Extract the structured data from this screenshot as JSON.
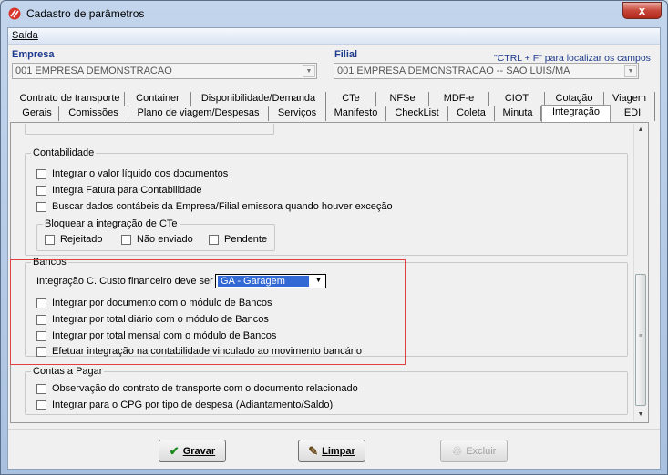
{
  "window": {
    "title": "Cadastro de parâmetros",
    "close_glyph": "x"
  },
  "menu": {
    "saida": "Saída"
  },
  "empresa": {
    "label": "Empresa",
    "value": "001 EMPRESA DEMONSTRACAO"
  },
  "filial": {
    "label": "Filial",
    "value": "001 EMPRESA DEMONSTRACAO -- SAO LUIS/MA",
    "hint": "\"CTRL + F\" para localizar os campos"
  },
  "tabs_row1": [
    "Contrato de transporte",
    "Container",
    "Disponibilidade/Demanda",
    "CTe",
    "NFSe",
    "MDF-e",
    "CIOT",
    "Cotação",
    "Viagem"
  ],
  "tabs_row2": [
    "Gerais",
    "Comissões",
    "Plano de viagem/Despesas",
    "Serviços",
    "Manifesto",
    "CheckList",
    "Coleta",
    "Minuta",
    "Integração",
    "EDI"
  ],
  "active_tab": "Integração",
  "contabilidade": {
    "title": "Contabilidade",
    "items": [
      "Integrar o valor líquido dos documentos",
      "Integra Fatura para Contabilidade",
      "Buscar dados contábeis da Empresa/Filial emissora quando houver exceção"
    ],
    "bloquear": {
      "title": "Bloquear a integração de CTe",
      "items": [
        "Rejeitado",
        "Não enviado",
        "Pendente"
      ]
    }
  },
  "bancos": {
    "title": "Bancos",
    "custo_label": "Integração C. Custo financeiro deve ser por",
    "custo_value": "GA - Garagem",
    "items": [
      "Integrar por documento com o módulo de Bancos",
      "Integrar por total diário com o módulo de Bancos",
      "Integrar por total mensal com o módulo de Bancos",
      "Efetuar integração na contabilidade vinculado ao movimento bancário"
    ]
  },
  "contas_pagar": {
    "title": "Contas a Pagar",
    "items": [
      "Observação do contrato de transporte com o documento relacionado",
      "Integrar para o CPG por tipo de despesa (Adiantamento/Saldo)"
    ]
  },
  "buttons": {
    "gravar": "Gravar",
    "limpar": "Limpar",
    "excluir": "Excluir"
  },
  "colors": {
    "highlight_border": "#e04040",
    "selection": "#3369d5",
    "label_blue": "#1d3a8c"
  }
}
